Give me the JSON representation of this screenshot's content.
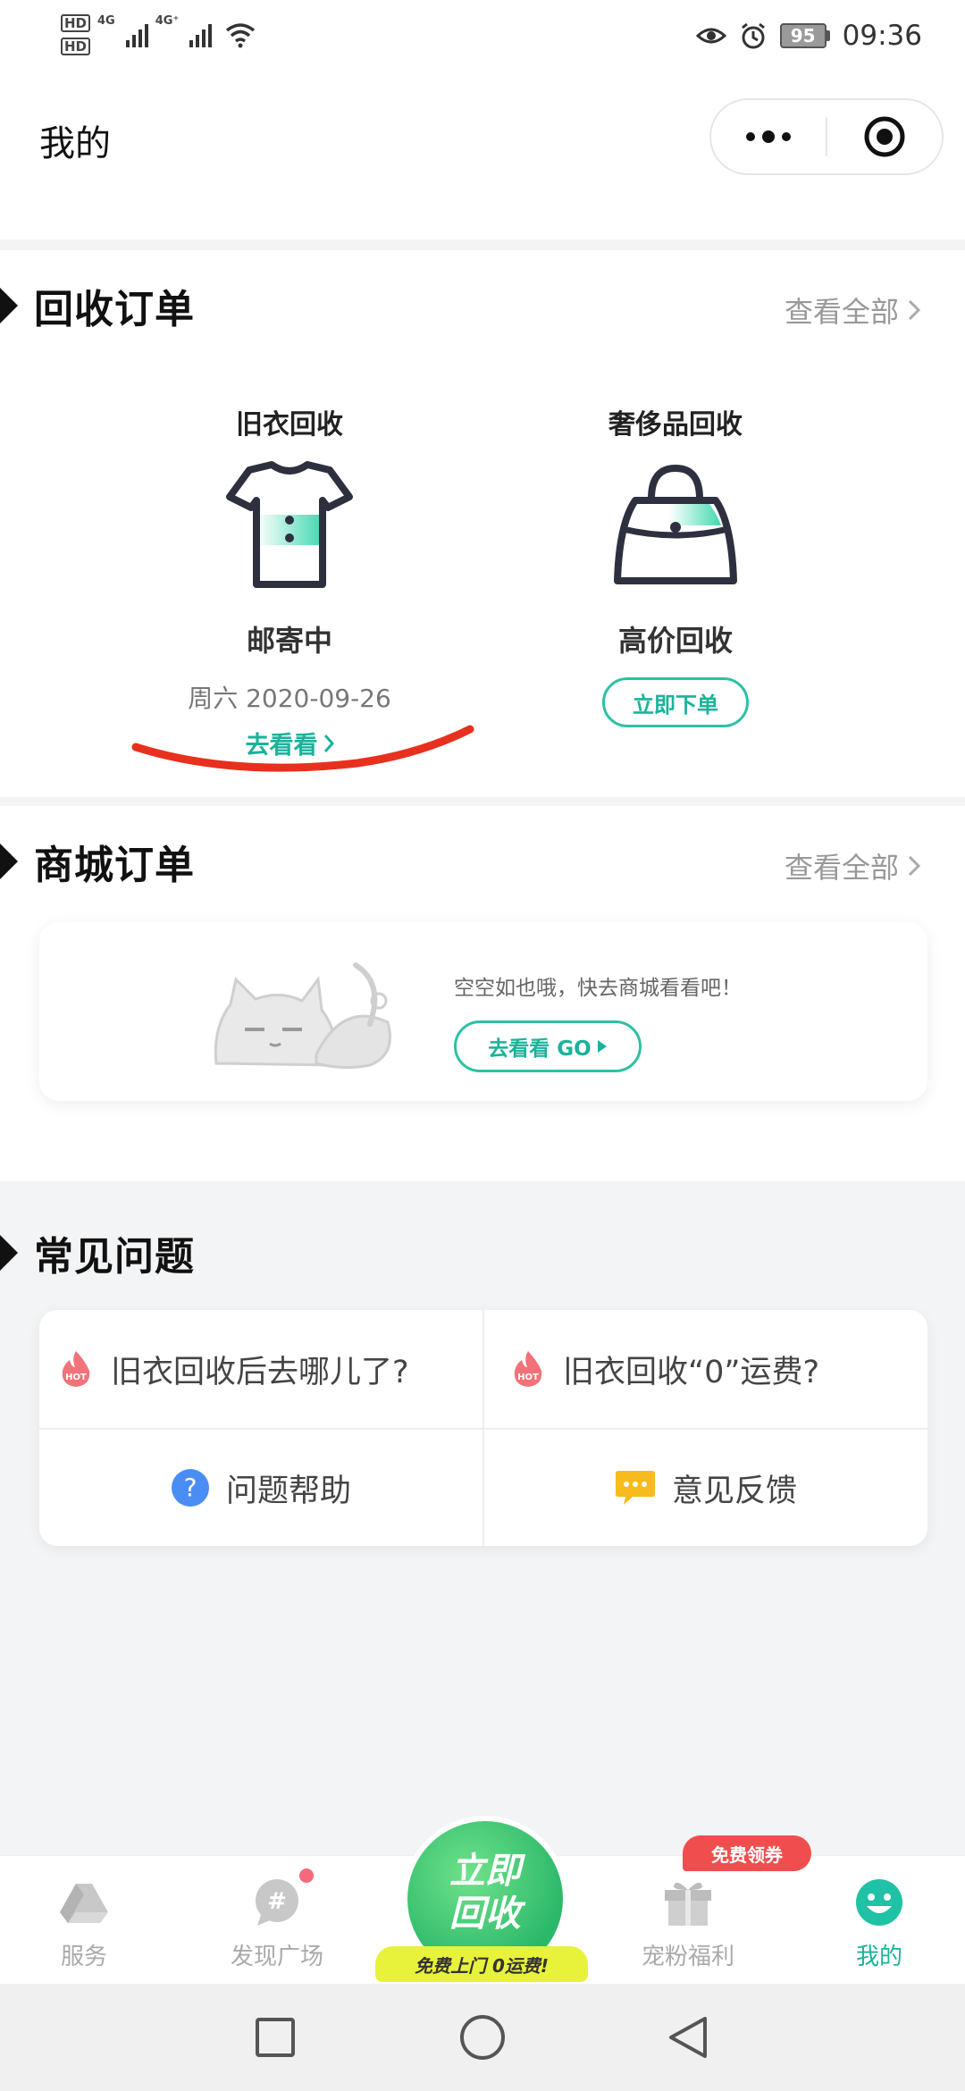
{
  "status_bar": {
    "hd1": "HD",
    "hd2": "HD",
    "net1": "4G",
    "net2": "4G⁺",
    "battery": "95",
    "time": "09:36"
  },
  "title_bar": {
    "title": "我的"
  },
  "recycle_orders": {
    "title": "回收订单",
    "view_all": "查看全部",
    "clothes": {
      "label": "旧衣回收",
      "status": "邮寄中",
      "date": "周六 2020-09-26",
      "link": "去看看"
    },
    "luxury": {
      "label": "奢侈品回收",
      "status": "高价回收",
      "button": "立即下单"
    }
  },
  "mall_orders": {
    "title": "商城订单",
    "view_all": "查看全部",
    "empty_text": "空空如也哦，快去商城看看吧！",
    "go_button": "去看看 GO"
  },
  "faq": {
    "title": "常见问题",
    "items": [
      {
        "text": "旧衣回收后去哪儿了?",
        "icon": "hot-fire-icon"
      },
      {
        "text": "旧衣回收“0”运费?",
        "icon": "hot-fire-icon"
      },
      {
        "text": "问题帮助",
        "icon": "question-icon"
      },
      {
        "text": "意见反馈",
        "icon": "feedback-icon"
      }
    ]
  },
  "tab_bar": {
    "tabs": [
      {
        "label": "服务",
        "icon": "service-icon"
      },
      {
        "label": "发现广场",
        "icon": "discover-icon"
      },
      {
        "label": "宠粉福利",
        "icon": "gift-icon"
      },
      {
        "label": "我的",
        "icon": "smile-icon"
      }
    ],
    "center_button": "立即回收",
    "center_line1": "立即",
    "center_line2": "回收",
    "center_strip": "免费上门 0运费!",
    "coupon_badge": "免费领券"
  },
  "colors": {
    "accent": "#1ab39a",
    "annotation_red": "#e8301e",
    "badge_red": "#f04e4e",
    "center_green": "#2bb86a"
  }
}
